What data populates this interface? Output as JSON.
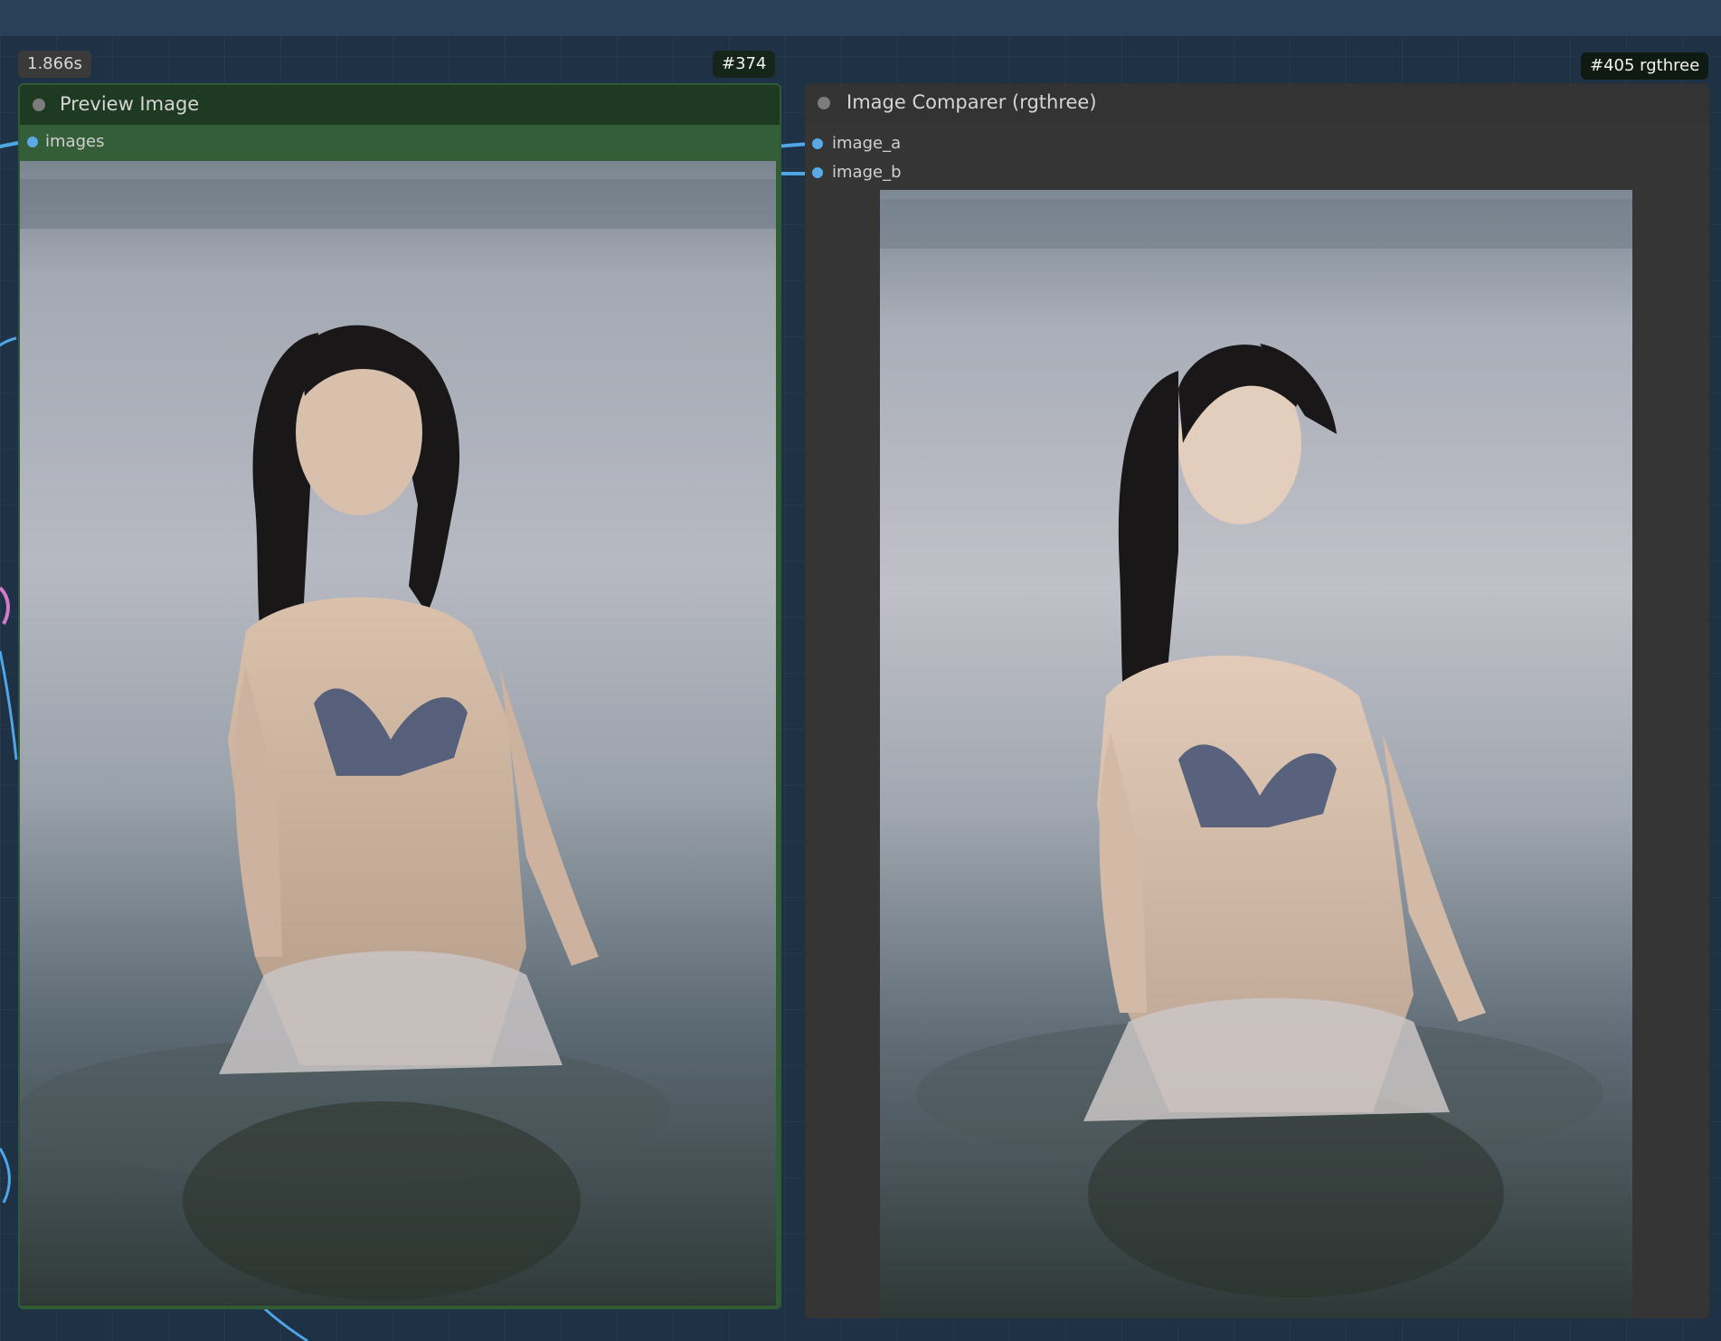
{
  "canvas": {
    "background_color": "#1f3145"
  },
  "preview_node": {
    "exec_time": "1.866s",
    "id_badge": "#374",
    "title": "Preview Image",
    "inputs": [
      {
        "label": "images"
      }
    ],
    "color": "#2f5d34"
  },
  "comparer_node": {
    "id_badge": "#405 rgthree",
    "title": "Image Comparer (rgthree)",
    "inputs": [
      {
        "label": "image_a"
      },
      {
        "label": "image_b"
      }
    ],
    "color": "#353535"
  },
  "icons": {
    "status_dot": "circle-dot-icon",
    "input_slot": "input-slot-dot-icon"
  },
  "accent_colors": {
    "slot_blue": "#5aa8e6",
    "wire_blue": "#4fa6e6",
    "wire_pink": "#d27cc9"
  }
}
